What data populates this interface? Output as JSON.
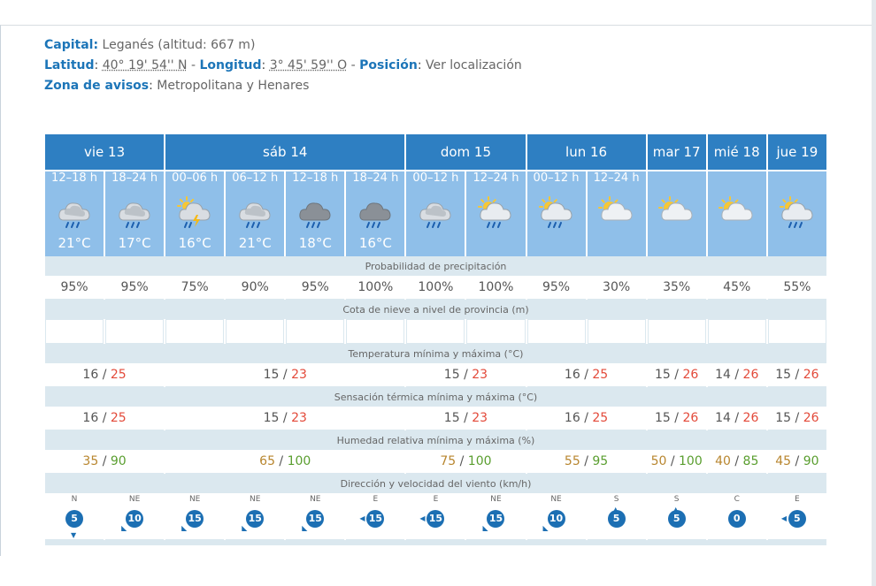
{
  "info": {
    "capital_label": "Capital",
    "capital_value": "Leganés (altitud: 667 m)",
    "lat_label": "Latitud",
    "lat_value": "40° 19' 54'' N",
    "lon_label": "Longitud",
    "lon_value": "3° 45' 59'' O",
    "pos_label": "Posición",
    "pos_link": "Ver localización",
    "zona_label": "Zona de avisos",
    "zona_value": "Metropolitana y Henares"
  },
  "days": [
    "vie 13",
    "sáb 14",
    "dom 15",
    "lun 16",
    "mar 17",
    "mié 18",
    "jue 19"
  ],
  "hours": [
    "12–18 h",
    "18–24 h",
    "00–06 h",
    "06–12 h",
    "12–18 h",
    "18–24 h",
    "00–12 h",
    "12–24 h",
    "00–12 h",
    "12–24 h"
  ],
  "temps": [
    "21°C",
    "17°C",
    "16°C",
    "21°C",
    "18°C",
    "16°C"
  ],
  "icons": [
    "cloud-rain-icon",
    "cloud-rain-icon",
    "storm-rain-icon",
    "cloud-rain-icon",
    "dark-cloud-rain-icon",
    "dark-cloud-rain-icon",
    "cloud-rain-icon",
    "sun-cloud-rain-icon",
    "sun-cloud-rain-icon",
    "sun-cloud-icon",
    "sun-cloud-icon",
    "sun-cloud-icon",
    "sun-cloud-rain-icon"
  ],
  "sections": {
    "precip": "Probabilidad de precipitación",
    "nieve": "Cota de nieve a nivel de provincia (m)",
    "temp": "Temperatura mínima y máxima (°C)",
    "sens": "Sensación térmica mínima y máxima (°C)",
    "hum": "Humedad relativa mínima y máxima (%)",
    "viento": "Dirección y velocidad del viento (km/h)"
  },
  "precip": [
    "95%",
    "95%",
    "75%",
    "90%",
    "95%",
    "100%",
    "100%",
    "100%",
    "95%",
    "30%",
    "35%",
    "45%",
    "55%"
  ],
  "temp_min": [
    "16",
    "15",
    "15",
    "16",
    "15",
    "14",
    "15"
  ],
  "temp_max": [
    "25",
    "23",
    "23",
    "25",
    "26",
    "26",
    "26"
  ],
  "sens_min": [
    "16",
    "15",
    "15",
    "16",
    "15",
    "14",
    "15"
  ],
  "sens_max": [
    "25",
    "23",
    "23",
    "25",
    "26",
    "26",
    "26"
  ],
  "hum_min": [
    "35",
    "65",
    "75",
    "55",
    "50",
    "40",
    "45"
  ],
  "hum_max": [
    "90",
    "100",
    "100",
    "95",
    "100",
    "85",
    "90"
  ],
  "separator": "/",
  "wind_dir": [
    "N",
    "NE",
    "NE",
    "NE",
    "NE",
    "E",
    "E",
    "NE",
    "NE",
    "S",
    "S",
    "C",
    "E"
  ],
  "wind_speed": [
    "5",
    "10",
    "15",
    "15",
    "15",
    "15",
    "15",
    "15",
    "10",
    "5",
    "5",
    "0",
    "5"
  ],
  "colors": {
    "header": "#2e7fc2",
    "subheader": "#8fbfe9",
    "section": "#dbe8ef",
    "label": "#1c75b8",
    "max_temp": "#e34a3a"
  }
}
